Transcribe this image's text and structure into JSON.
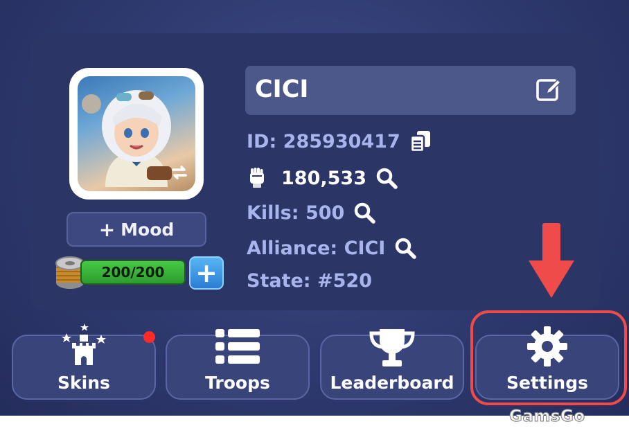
{
  "profile": {
    "name": "CICI",
    "id_label": "ID:",
    "id_value": "285930417",
    "power_value": "180,533",
    "kills_label": "Kills:",
    "kills_value": "500",
    "alliance_label": "Alliance:",
    "alliance_value": "CICI",
    "state_label": "State:",
    "state_value": "#520"
  },
  "mood_button": {
    "plus": "+",
    "label": "Mood"
  },
  "energy": {
    "value": "200/200",
    "plus": "+"
  },
  "nav": [
    {
      "label": "Skins",
      "icon": "castle-icon",
      "has_notification": true
    },
    {
      "label": "Troops",
      "icon": "list-icon",
      "has_notification": false
    },
    {
      "label": "Leaderboard",
      "icon": "trophy-icon",
      "has_notification": false
    },
    {
      "label": "Settings",
      "icon": "gear-icon",
      "has_notification": false
    }
  ],
  "watermark": "GamsGo",
  "colors": {
    "background": "#2d386d",
    "panel": "#2b3566",
    "highlight": "#ef4b4b",
    "energy_green": "#2d9d2d",
    "plus_blue": "#2b7dd3",
    "label_blue": "#a8b4ec",
    "notification_red": "#ff2a2a"
  }
}
